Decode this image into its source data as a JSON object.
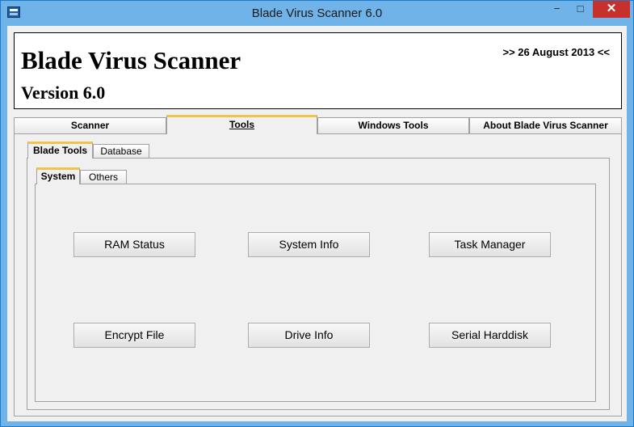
{
  "window": {
    "title": "Blade Virus Scanner 6.0",
    "controls": {
      "minimize": "−",
      "maximize": "□",
      "close": "✕"
    }
  },
  "header": {
    "app_title": "Blade Virus Scanner",
    "version": "Version 6.0",
    "date": ">> 26 August 2013 <<"
  },
  "main_tabs": [
    {
      "label": "Scanner",
      "active": false
    },
    {
      "label": "Tools",
      "active": true
    },
    {
      "label": "Windows Tools",
      "active": false
    },
    {
      "label": "About Blade Virus Scanner",
      "active": false
    }
  ],
  "tools_tabs": [
    {
      "label": "Blade Tools",
      "active": true
    },
    {
      "label": "Database",
      "active": false
    }
  ],
  "blade_tools_tabs": [
    {
      "label": "System",
      "active": true
    },
    {
      "label": "Others",
      "active": false
    }
  ],
  "system_buttons": [
    {
      "label": "RAM Status"
    },
    {
      "label": "System Info"
    },
    {
      "label": "Task Manager"
    },
    {
      "label": "Encrypt File"
    },
    {
      "label": "Drive Info"
    },
    {
      "label": "Serial Harddisk"
    }
  ],
  "colors": {
    "titlebar": "#6fb3e8",
    "close_button": "#c7302b",
    "active_tab_accent": "#f0c34a"
  }
}
